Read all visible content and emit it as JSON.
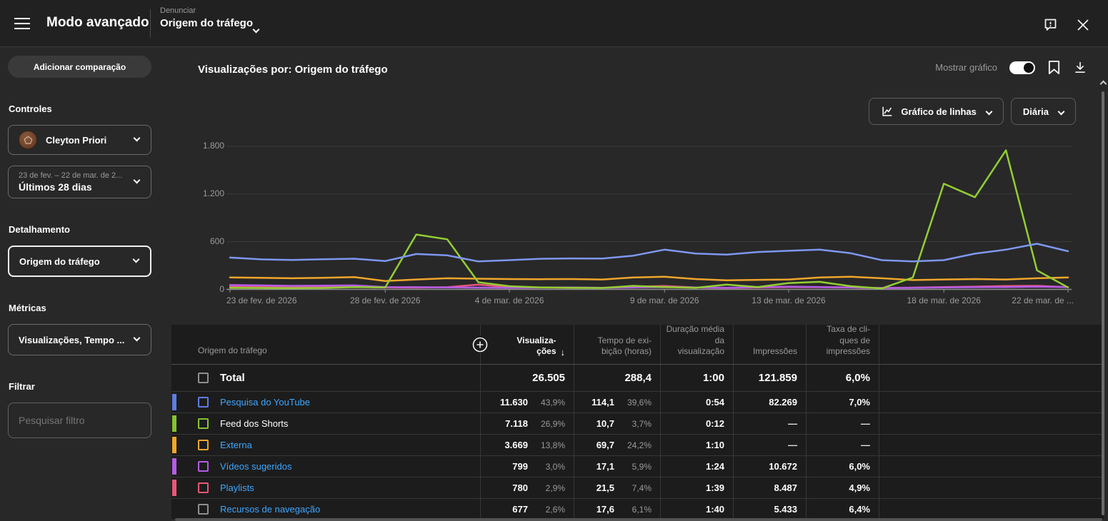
{
  "topbar": {
    "title": "Modo avançado",
    "dimension_label": "Denunciar",
    "dimension_value": "Origem do tráfego"
  },
  "sidebar": {
    "compare_button": "Adicionar comparação",
    "controls_heading": "Controles",
    "channel_name": "Cleyton Priori",
    "date_range_sub": "23 de fev. – 22 de mar. de 2...",
    "date_range_main": "Últimos 28 dias",
    "detail_heading": "Detalhamento",
    "detail_value": "Origem do tráfego",
    "metrics_heading": "Métricas",
    "metrics_value": "Visualizações, Tempo ...",
    "filter_heading": "Filtrar",
    "filter_placeholder": "Pesquisar filtro"
  },
  "main": {
    "title": "Visualizações por: Origem do tráfego",
    "show_chart_label": "Mostrar gráfico",
    "chart_type_button": "Gráfico de linhas",
    "interval_button": "Diária"
  },
  "chart_data": {
    "type": "line",
    "title": "Visualizações por: Origem do tráfego",
    "interval": "Diária",
    "ylim": [
      0,
      1800
    ],
    "y_ticks": [
      {
        "value": 0,
        "label": "0"
      },
      {
        "value": 600,
        "label": "600"
      },
      {
        "value": 1200,
        "label": "1.200"
      },
      {
        "value": 1800,
        "label": "1.800"
      }
    ],
    "num_days": 28,
    "x_ticks": [
      {
        "day_index": 0,
        "label": "23 de fev. de 2026"
      },
      {
        "day_index": 5,
        "label": "28 de fev. de 2026"
      },
      {
        "day_index": 9,
        "label": "4 de mar. de 2026"
      },
      {
        "day_index": 14,
        "label": "9 de mar. de 2026"
      },
      {
        "day_index": 18,
        "label": "13 de mar. de 2026"
      },
      {
        "day_index": 23,
        "label": "18 de mar. de 2026"
      },
      {
        "day_index": 27,
        "label": "22 de mar. de ..."
      }
    ],
    "series": [
      {
        "name": "Playlists",
        "color": "#e85878",
        "values": [
          40,
          38,
          35,
          30,
          32,
          25,
          22,
          28,
          60,
          30,
          25,
          22,
          20,
          35,
          42,
          25,
          18,
          25,
          30,
          28,
          25,
          18,
          22,
          30,
          35,
          42,
          45,
          28
        ]
      },
      {
        "name": "Vídeos sugeridos",
        "color": "#b55ce6",
        "values": [
          55,
          50,
          45,
          48,
          50,
          30,
          28,
          25,
          22,
          20,
          22,
          25,
          20,
          25,
          30,
          25,
          20,
          28,
          35,
          30,
          25,
          18,
          20,
          25,
          28,
          30,
          35,
          30
        ]
      },
      {
        "name": "Externa",
        "color": "#f0a62b",
        "values": [
          150,
          145,
          140,
          145,
          155,
          105,
          125,
          140,
          135,
          130,
          128,
          130,
          125,
          150,
          160,
          130,
          115,
          120,
          125,
          150,
          160,
          140,
          118,
          125,
          130,
          125,
          140,
          150
        ]
      },
      {
        "name": "Feed dos Shorts",
        "color": "#93ce33",
        "values": [
          20,
          18,
          15,
          18,
          30,
          25,
          690,
          630,
          90,
          40,
          25,
          20,
          18,
          45,
          30,
          20,
          60,
          30,
          80,
          95,
          40,
          12,
          150,
          1330,
          1160,
          1750,
          240,
          25
        ]
      },
      {
        "name": "Pesquisa do YouTube",
        "color": "#7e97f0",
        "values": [
          400,
          378,
          370,
          380,
          386,
          356,
          445,
          428,
          352,
          368,
          385,
          390,
          388,
          425,
          500,
          452,
          438,
          470,
          486,
          500,
          455,
          368,
          352,
          368,
          450,
          500,
          575,
          480
        ]
      }
    ]
  },
  "table": {
    "dimension_header": "Origem do tráfego",
    "sort_arrow": "↓",
    "headers": [
      {
        "key": "views",
        "label": "Visualiza-\nções",
        "sorted": true
      },
      {
        "key": "watch",
        "label": "Tempo de exi-\nbição (horas)",
        "sorted": false
      },
      {
        "key": "avg",
        "label": "Duração média\nda\nvisualização",
        "sorted": false
      },
      {
        "key": "impressions",
        "label": "Impressões",
        "sorted": false
      },
      {
        "key": "ctr",
        "label": "Taxa de cli-\nques de\nimpressões",
        "sorted": false
      }
    ],
    "total": {
      "label": "Total",
      "views": "26.505",
      "watch": "288,4",
      "avg": "1:00",
      "impressions": "121.859",
      "ctr": "6,0%"
    },
    "rows": [
      {
        "label": "Pesquisa do YouTube",
        "link": true,
        "color": "#5e7ce2",
        "views": "11.630",
        "views_pct": "43,9%",
        "watch": "114,1",
        "watch_pct": "39,6%",
        "avg": "0:54",
        "impressions": "82.269",
        "ctr": "7,0%"
      },
      {
        "label": "Feed dos Shorts",
        "link": false,
        "color": "#85c232",
        "views": "7.118",
        "views_pct": "26,9%",
        "watch": "10,7",
        "watch_pct": "3,7%",
        "avg": "0:12",
        "impressions": "—",
        "ctr": "—"
      },
      {
        "label": "Externa",
        "link": true,
        "color": "#f0a62b",
        "views": "3.669",
        "views_pct": "13,8%",
        "watch": "69,7",
        "watch_pct": "24,2%",
        "avg": "1:10",
        "impressions": "—",
        "ctr": "—"
      },
      {
        "label": "Vídeos sugeridos",
        "link": true,
        "color": "#b55ce6",
        "views": "799",
        "views_pct": "3,0%",
        "watch": "17,1",
        "watch_pct": "5,9%",
        "avg": "1:24",
        "impressions": "10.672",
        "ctr": "6,0%"
      },
      {
        "label": "Playlists",
        "link": true,
        "color": "#e85878",
        "views": "780",
        "views_pct": "2,9%",
        "watch": "21,5",
        "watch_pct": "7,4%",
        "avg": "1:39",
        "impressions": "8.487",
        "ctr": "4,9%"
      },
      {
        "label": "Recursos de navegação",
        "link": true,
        "color": null,
        "views": "677",
        "views_pct": "2,6%",
        "watch": "17,6",
        "watch_pct": "6,1%",
        "avg": "1:40",
        "impressions": "5.433",
        "ctr": "6,4%"
      }
    ]
  }
}
